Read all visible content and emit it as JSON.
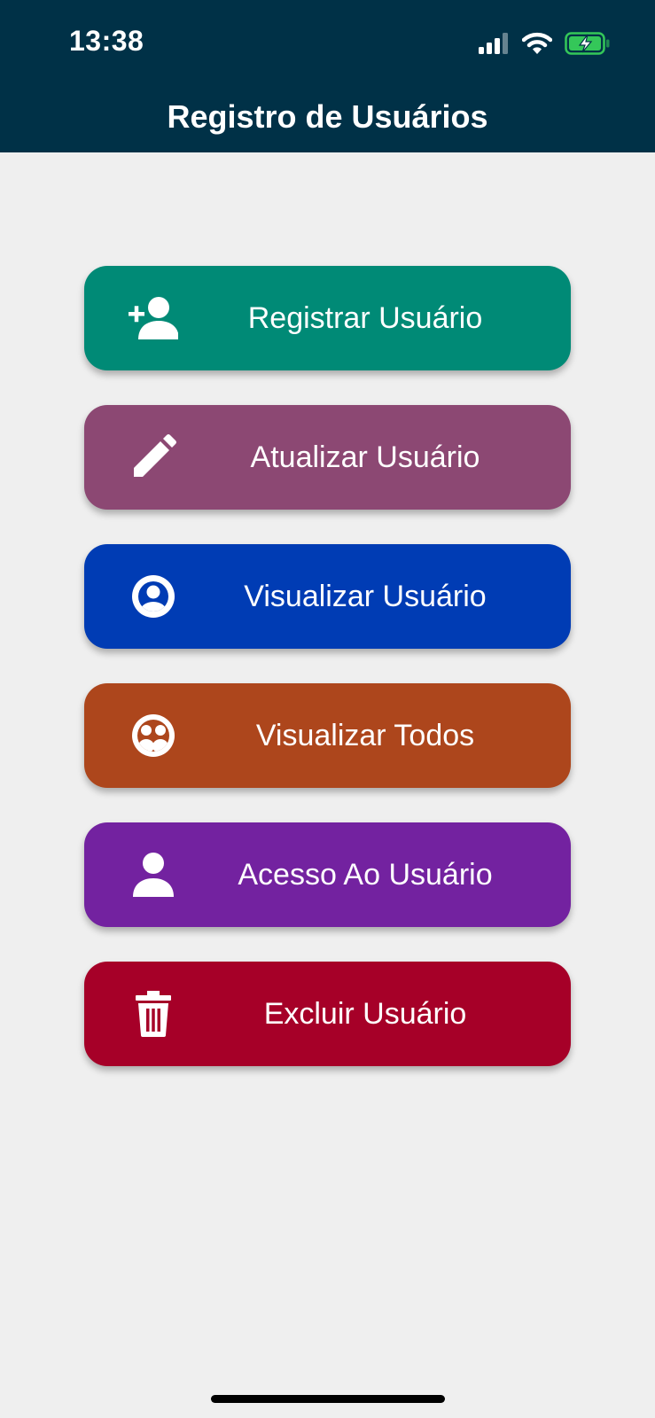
{
  "status_bar": {
    "time": "13:38",
    "icons": [
      "signal-icon",
      "wifi-icon",
      "battery-charging-icon"
    ]
  },
  "header": {
    "title": "Registro de Usuários",
    "background": "#003147"
  },
  "menu": [
    {
      "label": "Registrar Usuário",
      "icon": "person-add-icon",
      "color": "#008a76"
    },
    {
      "label": "Atualizar Usuário",
      "icon": "pencil-icon",
      "color": "#8c4873"
    },
    {
      "label": "Visualizar Usuário",
      "icon": "account-circle-icon",
      "color": "#003cb4"
    },
    {
      "label": "Visualizar Todos",
      "icon": "group-circle-icon",
      "color": "#ad461c"
    },
    {
      "label": "Acesso Ao Usuário",
      "icon": "person-icon",
      "color": "#7322a0"
    },
    {
      "label": "Excluir Usuário",
      "icon": "trash-icon",
      "color": "#a60028"
    }
  ]
}
